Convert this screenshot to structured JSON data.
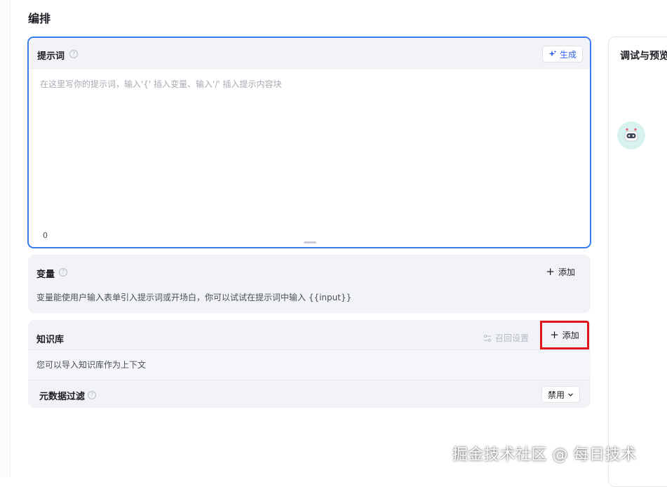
{
  "page": {
    "title": "编排"
  },
  "prompt": {
    "label": "提示词",
    "help": "?",
    "generate_label": "生成",
    "placeholder": "在这里写你的提示词，输入'{' 插入变量、输入'/' 插入提示内容块",
    "char_count": "0"
  },
  "variables": {
    "label": "变量",
    "help": "?",
    "add_label": "添加",
    "description": "变量能使用户输入表单引入提示词或开场白，你可以试试在提示词中输入 {{input}}"
  },
  "knowledge": {
    "label": "知识库",
    "recall_label": "召回设置",
    "add_label": "添加",
    "description": "您可以导入知识库作为上下文",
    "meta_filter": {
      "label": "元数据过滤",
      "help": "?",
      "selected": "禁用"
    }
  },
  "preview": {
    "title": "调试与预览"
  },
  "watermark": "掘金技术社区 @ 每日技术",
  "colors": {
    "accent": "#3a7bf0",
    "highlight_box": "#e0151b"
  }
}
